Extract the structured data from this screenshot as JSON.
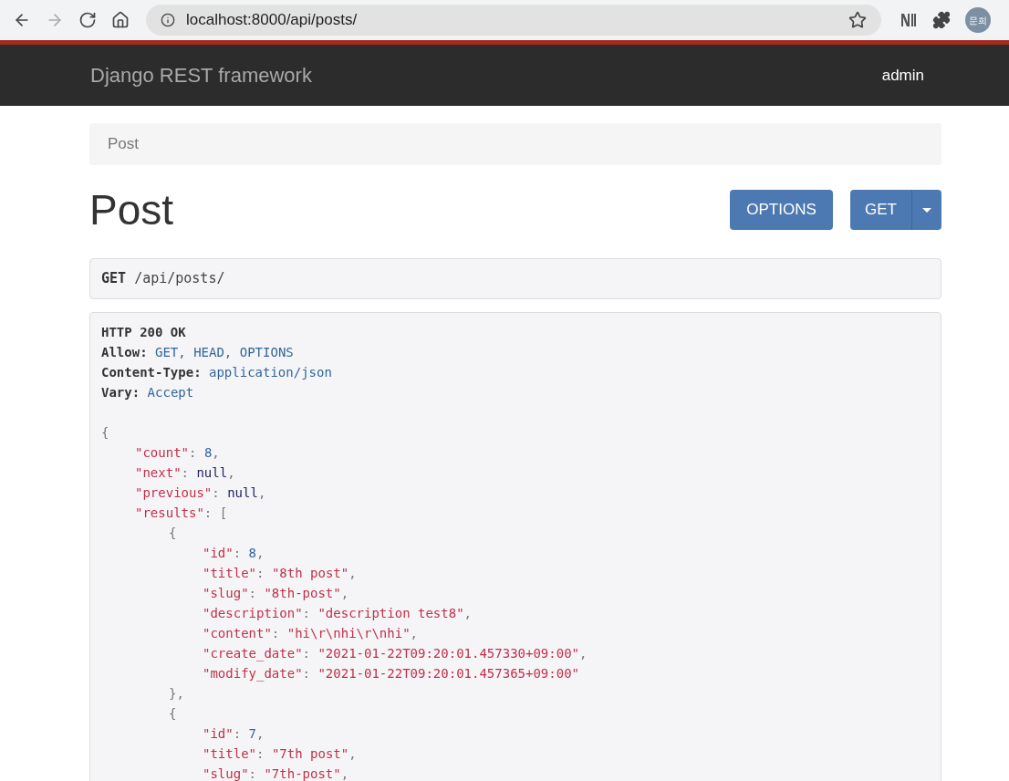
{
  "browser": {
    "url": "localhost:8000/api/posts/",
    "profile": "문희"
  },
  "navbar": {
    "brand": "Django REST framework",
    "user": "admin"
  },
  "breadcrumb": [
    {
      "label": "Post",
      "selected": true
    }
  ],
  "page": {
    "title": "Post",
    "buttons": [
      {
        "label": "OPTIONS",
        "kind": "plain"
      },
      {
        "label": "GET",
        "kind": "split"
      }
    ]
  },
  "request": {
    "method": "GET",
    "path": "/api/posts/"
  },
  "response": {
    "status": "HTTP 200 OK",
    "headers": [
      {
        "name": "Allow:",
        "value": "GET, HEAD, OPTIONS"
      },
      {
        "name": "Content-Type:",
        "value": "application/json"
      },
      {
        "name": "Vary:",
        "value": "Accept"
      }
    ],
    "body": [
      {
        "tokens": [
          {
            "kind": "punct",
            "text": "{"
          }
        ],
        "children": [
          {
            "tokens": [
              {
                "kind": "key",
                "text": "\"count\""
              },
              {
                "kind": "punct",
                "text": ": "
              },
              {
                "kind": "number",
                "text": "8"
              },
              {
                "kind": "punct",
                "text": ","
              }
            ]
          },
          {
            "tokens": [
              {
                "kind": "key",
                "text": "\"next\""
              },
              {
                "kind": "punct",
                "text": ": "
              },
              {
                "kind": "literal",
                "text": "null"
              },
              {
                "kind": "punct",
                "text": ","
              }
            ]
          },
          {
            "tokens": [
              {
                "kind": "key",
                "text": "\"previous\""
              },
              {
                "kind": "punct",
                "text": ": "
              },
              {
                "kind": "literal",
                "text": "null"
              },
              {
                "kind": "punct",
                "text": ","
              }
            ]
          },
          {
            "tokens": [
              {
                "kind": "key",
                "text": "\"results\""
              },
              {
                "kind": "punct",
                "text": ": ["
              }
            ],
            "children": [
              {
                "tokens": [
                  {
                    "kind": "punct",
                    "text": "{"
                  }
                ],
                "children": [
                  {
                    "tokens": [
                      {
                        "kind": "key",
                        "text": "\"id\""
                      },
                      {
                        "kind": "punct",
                        "text": ": "
                      },
                      {
                        "kind": "number",
                        "text": "8"
                      },
                      {
                        "kind": "punct",
                        "text": ","
                      }
                    ]
                  },
                  {
                    "tokens": [
                      {
                        "kind": "key",
                        "text": "\"title\""
                      },
                      {
                        "kind": "punct",
                        "text": ": "
                      },
                      {
                        "kind": "string",
                        "text": "\"8th post\""
                      },
                      {
                        "kind": "punct",
                        "text": ","
                      }
                    ]
                  },
                  {
                    "tokens": [
                      {
                        "kind": "key",
                        "text": "\"slug\""
                      },
                      {
                        "kind": "punct",
                        "text": ": "
                      },
                      {
                        "kind": "string",
                        "text": "\"8th-post\""
                      },
                      {
                        "kind": "punct",
                        "text": ","
                      }
                    ]
                  },
                  {
                    "tokens": [
                      {
                        "kind": "key",
                        "text": "\"description\""
                      },
                      {
                        "kind": "punct",
                        "text": ": "
                      },
                      {
                        "kind": "string",
                        "text": "\"description test8\""
                      },
                      {
                        "kind": "punct",
                        "text": ","
                      }
                    ]
                  },
                  {
                    "tokens": [
                      {
                        "kind": "key",
                        "text": "\"content\""
                      },
                      {
                        "kind": "punct",
                        "text": ": "
                      },
                      {
                        "kind": "string",
                        "text": "\"hi\\r\\nhi\\r\\nhi\""
                      },
                      {
                        "kind": "punct",
                        "text": ","
                      }
                    ]
                  },
                  {
                    "tokens": [
                      {
                        "kind": "key",
                        "text": "\"create_date\""
                      },
                      {
                        "kind": "punct",
                        "text": ": "
                      },
                      {
                        "kind": "string",
                        "text": "\"2021-01-22T09:20:01.457330+09:00\""
                      },
                      {
                        "kind": "punct",
                        "text": ","
                      }
                    ]
                  },
                  {
                    "tokens": [
                      {
                        "kind": "key",
                        "text": "\"modify_date\""
                      },
                      {
                        "kind": "punct",
                        "text": ": "
                      },
                      {
                        "kind": "string",
                        "text": "\"2021-01-22T09:20:01.457365+09:00\""
                      }
                    ]
                  }
                ]
              },
              {
                "tokens": [
                  {
                    "kind": "punct",
                    "text": "},"
                  }
                ]
              },
              {
                "tokens": [
                  {
                    "kind": "punct",
                    "text": "{"
                  }
                ],
                "children": [
                  {
                    "tokens": [
                      {
                        "kind": "key",
                        "text": "\"id\""
                      },
                      {
                        "kind": "punct",
                        "text": ": "
                      },
                      {
                        "kind": "number",
                        "text": "7"
                      },
                      {
                        "kind": "punct",
                        "text": ","
                      }
                    ]
                  },
                  {
                    "tokens": [
                      {
                        "kind": "key",
                        "text": "\"title\""
                      },
                      {
                        "kind": "punct",
                        "text": ": "
                      },
                      {
                        "kind": "string",
                        "text": "\"7th post\""
                      },
                      {
                        "kind": "punct",
                        "text": ","
                      }
                    ]
                  },
                  {
                    "tokens": [
                      {
                        "kind": "key",
                        "text": "\"slug\""
                      },
                      {
                        "kind": "punct",
                        "text": ": "
                      },
                      {
                        "kind": "string",
                        "text": "\"7th-post\""
                      },
                      {
                        "kind": "punct",
                        "text": ","
                      }
                    ]
                  }
                ]
              }
            ]
          }
        ]
      }
    ]
  }
}
